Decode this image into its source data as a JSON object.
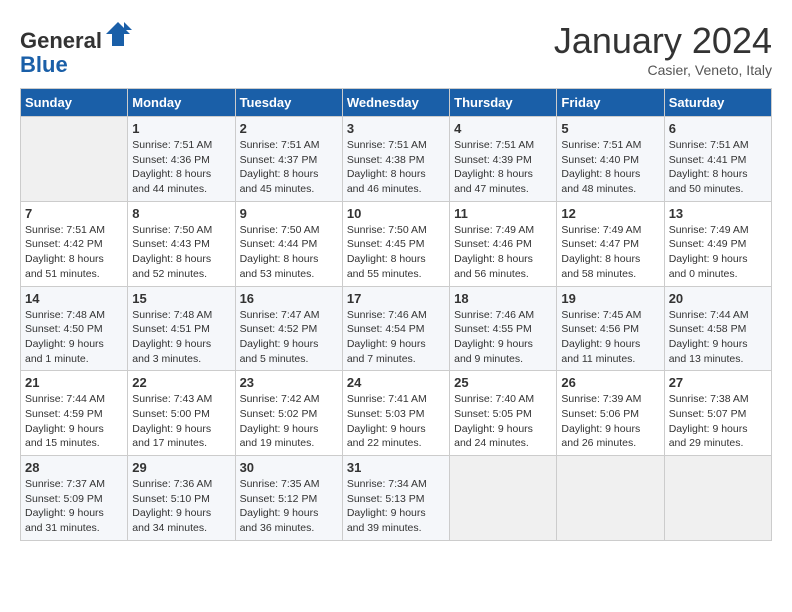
{
  "header": {
    "logo_general": "General",
    "logo_blue": "Blue",
    "month_title": "January 2024",
    "subtitle": "Casier, Veneto, Italy"
  },
  "columns": [
    "Sunday",
    "Monday",
    "Tuesday",
    "Wednesday",
    "Thursday",
    "Friday",
    "Saturday"
  ],
  "weeks": [
    [
      {
        "day": "",
        "info": ""
      },
      {
        "day": "1",
        "info": "Sunrise: 7:51 AM\nSunset: 4:36 PM\nDaylight: 8 hours\nand 44 minutes."
      },
      {
        "day": "2",
        "info": "Sunrise: 7:51 AM\nSunset: 4:37 PM\nDaylight: 8 hours\nand 45 minutes."
      },
      {
        "day": "3",
        "info": "Sunrise: 7:51 AM\nSunset: 4:38 PM\nDaylight: 8 hours\nand 46 minutes."
      },
      {
        "day": "4",
        "info": "Sunrise: 7:51 AM\nSunset: 4:39 PM\nDaylight: 8 hours\nand 47 minutes."
      },
      {
        "day": "5",
        "info": "Sunrise: 7:51 AM\nSunset: 4:40 PM\nDaylight: 8 hours\nand 48 minutes."
      },
      {
        "day": "6",
        "info": "Sunrise: 7:51 AM\nSunset: 4:41 PM\nDaylight: 8 hours\nand 50 minutes."
      }
    ],
    [
      {
        "day": "7",
        "info": "Sunrise: 7:51 AM\nSunset: 4:42 PM\nDaylight: 8 hours\nand 51 minutes."
      },
      {
        "day": "8",
        "info": "Sunrise: 7:50 AM\nSunset: 4:43 PM\nDaylight: 8 hours\nand 52 minutes."
      },
      {
        "day": "9",
        "info": "Sunrise: 7:50 AM\nSunset: 4:44 PM\nDaylight: 8 hours\nand 53 minutes."
      },
      {
        "day": "10",
        "info": "Sunrise: 7:50 AM\nSunset: 4:45 PM\nDaylight: 8 hours\nand 55 minutes."
      },
      {
        "day": "11",
        "info": "Sunrise: 7:49 AM\nSunset: 4:46 PM\nDaylight: 8 hours\nand 56 minutes."
      },
      {
        "day": "12",
        "info": "Sunrise: 7:49 AM\nSunset: 4:47 PM\nDaylight: 8 hours\nand 58 minutes."
      },
      {
        "day": "13",
        "info": "Sunrise: 7:49 AM\nSunset: 4:49 PM\nDaylight: 9 hours\nand 0 minutes."
      }
    ],
    [
      {
        "day": "14",
        "info": "Sunrise: 7:48 AM\nSunset: 4:50 PM\nDaylight: 9 hours\nand 1 minute."
      },
      {
        "day": "15",
        "info": "Sunrise: 7:48 AM\nSunset: 4:51 PM\nDaylight: 9 hours\nand 3 minutes."
      },
      {
        "day": "16",
        "info": "Sunrise: 7:47 AM\nSunset: 4:52 PM\nDaylight: 9 hours\nand 5 minutes."
      },
      {
        "day": "17",
        "info": "Sunrise: 7:46 AM\nSunset: 4:54 PM\nDaylight: 9 hours\nand 7 minutes."
      },
      {
        "day": "18",
        "info": "Sunrise: 7:46 AM\nSunset: 4:55 PM\nDaylight: 9 hours\nand 9 minutes."
      },
      {
        "day": "19",
        "info": "Sunrise: 7:45 AM\nSunset: 4:56 PM\nDaylight: 9 hours\nand 11 minutes."
      },
      {
        "day": "20",
        "info": "Sunrise: 7:44 AM\nSunset: 4:58 PM\nDaylight: 9 hours\nand 13 minutes."
      }
    ],
    [
      {
        "day": "21",
        "info": "Sunrise: 7:44 AM\nSunset: 4:59 PM\nDaylight: 9 hours\nand 15 minutes."
      },
      {
        "day": "22",
        "info": "Sunrise: 7:43 AM\nSunset: 5:00 PM\nDaylight: 9 hours\nand 17 minutes."
      },
      {
        "day": "23",
        "info": "Sunrise: 7:42 AM\nSunset: 5:02 PM\nDaylight: 9 hours\nand 19 minutes."
      },
      {
        "day": "24",
        "info": "Sunrise: 7:41 AM\nSunset: 5:03 PM\nDaylight: 9 hours\nand 22 minutes."
      },
      {
        "day": "25",
        "info": "Sunrise: 7:40 AM\nSunset: 5:05 PM\nDaylight: 9 hours\nand 24 minutes."
      },
      {
        "day": "26",
        "info": "Sunrise: 7:39 AM\nSunset: 5:06 PM\nDaylight: 9 hours\nand 26 minutes."
      },
      {
        "day": "27",
        "info": "Sunrise: 7:38 AM\nSunset: 5:07 PM\nDaylight: 9 hours\nand 29 minutes."
      }
    ],
    [
      {
        "day": "28",
        "info": "Sunrise: 7:37 AM\nSunset: 5:09 PM\nDaylight: 9 hours\nand 31 minutes."
      },
      {
        "day": "29",
        "info": "Sunrise: 7:36 AM\nSunset: 5:10 PM\nDaylight: 9 hours\nand 34 minutes."
      },
      {
        "day": "30",
        "info": "Sunrise: 7:35 AM\nSunset: 5:12 PM\nDaylight: 9 hours\nand 36 minutes."
      },
      {
        "day": "31",
        "info": "Sunrise: 7:34 AM\nSunset: 5:13 PM\nDaylight: 9 hours\nand 39 minutes."
      },
      {
        "day": "",
        "info": ""
      },
      {
        "day": "",
        "info": ""
      },
      {
        "day": "",
        "info": ""
      }
    ]
  ]
}
